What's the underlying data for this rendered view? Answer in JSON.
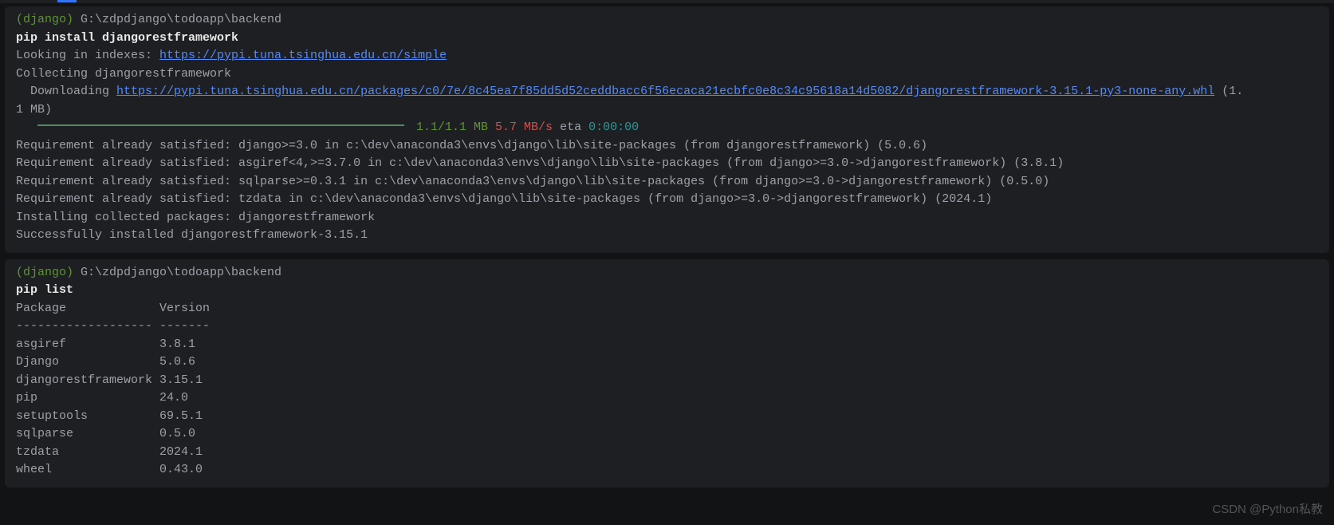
{
  "top_panel": {
    "prompt_env": "(django)",
    "prompt_path": " G:\\zdpdjango\\todoapp\\backend",
    "command": "pip install djangorestframework",
    "looking_prefix": "Looking in indexes: ",
    "index_url": "https://pypi.tuna.tsinghua.edu.cn/simple",
    "collecting": "Collecting djangorestframework",
    "downloading_prefix": "  Downloading ",
    "download_url": "https://pypi.tuna.tsinghua.edu.cn/packages/c0/7e/8c45ea7f85dd5d52ceddbacc6f56ecaca21ecbfc0e8c34c95618a14d5082/djangorestframework-3.15.1-py3-none-any.whl",
    "download_size": " (1.1 MB)",
    "progress_done": " 1.1/1.1 MB",
    "progress_speed": " 5.7 MB/s",
    "progress_eta_label": " eta ",
    "progress_eta": "0:00:00",
    "req1": "Requirement already satisfied: django>=3.0 in c:\\dev\\anaconda3\\envs\\django\\lib\\site-packages (from djangorestframework) (5.0.6)",
    "req2": "Requirement already satisfied: asgiref<4,>=3.7.0 in c:\\dev\\anaconda3\\envs\\django\\lib\\site-packages (from django>=3.0->djangorestframework) (3.8.1)",
    "req3": "Requirement already satisfied: sqlparse>=0.3.1 in c:\\dev\\anaconda3\\envs\\django\\lib\\site-packages (from django>=3.0->djangorestframework) (0.5.0)",
    "req4": "Requirement already satisfied: tzdata in c:\\dev\\anaconda3\\envs\\django\\lib\\site-packages (from django>=3.0->djangorestframework) (2024.1)",
    "installing": "Installing collected packages: djangorestframework",
    "success": "Successfully installed djangorestframework-3.15.1"
  },
  "bottom_panel": {
    "prompt_env": "(django)",
    "prompt_path": " G:\\zdpdjango\\todoapp\\backend",
    "command": "pip list",
    "header": "Package             Version",
    "divider": "------------------- -------",
    "rows": {
      "r0": "asgiref             3.8.1",
      "r1": "Django              5.0.6",
      "r2": "djangorestframework 3.15.1",
      "r3": "pip                 24.0",
      "r4": "setuptools          69.5.1",
      "r5": "sqlparse            0.5.0",
      "r6": "tzdata              2024.1",
      "r7": "wheel               0.43.0"
    }
  },
  "watermark": "CSDN @Python私教"
}
